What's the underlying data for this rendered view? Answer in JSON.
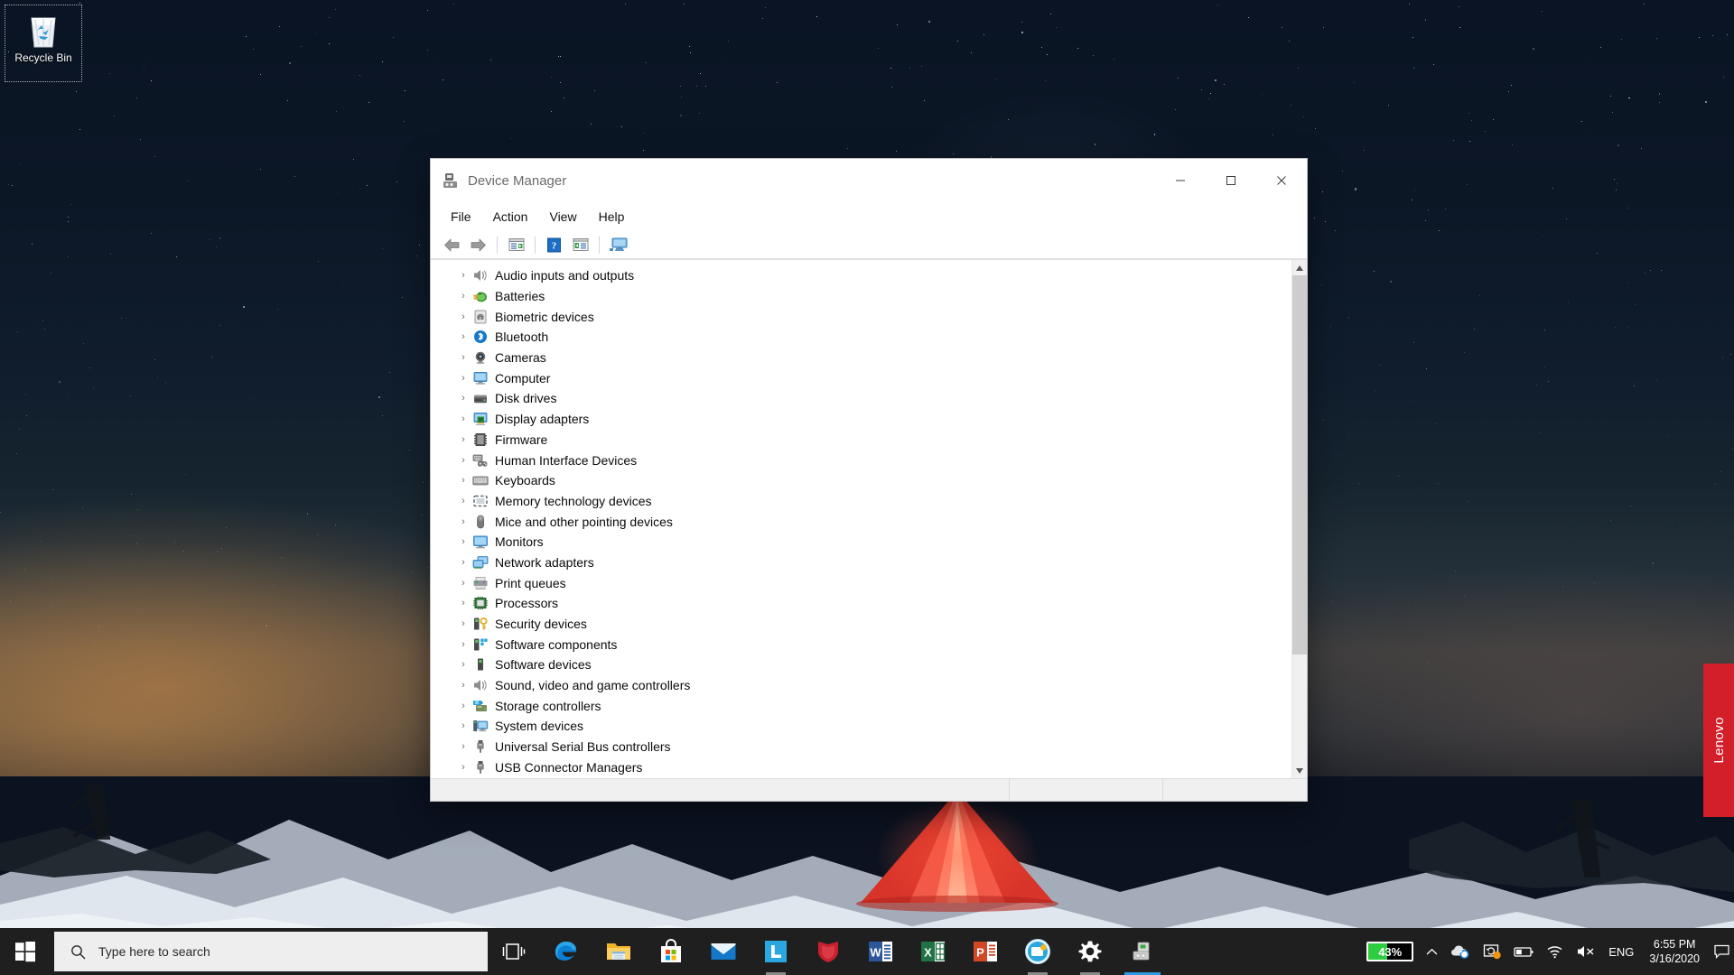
{
  "desktop": {
    "recycle_bin": {
      "label": "Recycle Bin",
      "icon": "recycle-bin-icon"
    },
    "lenovo_tab": {
      "label": "Lenovo"
    }
  },
  "window": {
    "title": "Device Manager",
    "title_icon": "device-manager-icon",
    "controls": {
      "minimize": "—",
      "maximize": "□",
      "close": "✕"
    },
    "menu": [
      {
        "label": "File"
      },
      {
        "label": "Action"
      },
      {
        "label": "View"
      },
      {
        "label": "Help"
      }
    ],
    "toolbar": [
      {
        "name": "back-arrow-icon",
        "title": "Back"
      },
      {
        "name": "forward-arrow-icon",
        "title": "Forward"
      },
      {
        "name": "separator"
      },
      {
        "name": "properties-icon",
        "title": "Properties"
      },
      {
        "name": "separator"
      },
      {
        "name": "help-icon",
        "title": "Help"
      },
      {
        "name": "show-hide-console-tree-icon",
        "title": "Show/Hide Console Tree"
      },
      {
        "name": "separator"
      },
      {
        "name": "scan-hardware-changes-icon",
        "title": "Scan for hardware changes"
      }
    ],
    "tree": [
      {
        "label": "Audio inputs and outputs",
        "icon": "speaker-icon"
      },
      {
        "label": "Batteries",
        "icon": "battery-icon"
      },
      {
        "label": "Biometric devices",
        "icon": "fingerprint-icon"
      },
      {
        "label": "Bluetooth",
        "icon": "bluetooth-icon"
      },
      {
        "label": "Cameras",
        "icon": "camera-icon"
      },
      {
        "label": "Computer",
        "icon": "computer-icon"
      },
      {
        "label": "Disk drives",
        "icon": "disk-drive-icon"
      },
      {
        "label": "Display adapters",
        "icon": "display-adapter-icon"
      },
      {
        "label": "Firmware",
        "icon": "firmware-chip-icon"
      },
      {
        "label": "Human Interface Devices",
        "icon": "hid-icon"
      },
      {
        "label": "Keyboards",
        "icon": "keyboard-icon"
      },
      {
        "label": "Memory technology devices",
        "icon": "memory-icon"
      },
      {
        "label": "Mice and other pointing devices",
        "icon": "mouse-icon"
      },
      {
        "label": "Monitors",
        "icon": "monitor-icon"
      },
      {
        "label": "Network adapters",
        "icon": "network-adapter-icon"
      },
      {
        "label": "Print queues",
        "icon": "printer-icon"
      },
      {
        "label": "Processors",
        "icon": "processor-icon"
      },
      {
        "label": "Security devices",
        "icon": "security-key-icon"
      },
      {
        "label": "Software components",
        "icon": "software-component-icon"
      },
      {
        "label": "Software devices",
        "icon": "software-device-icon"
      },
      {
        "label": "Sound, video and game controllers",
        "icon": "speaker-icon"
      },
      {
        "label": "Storage controllers",
        "icon": "storage-controller-icon"
      },
      {
        "label": "System devices",
        "icon": "system-device-icon"
      },
      {
        "label": "Universal Serial Bus controllers",
        "icon": "usb-icon"
      },
      {
        "label": "USB Connector Managers",
        "icon": "usb-icon"
      }
    ],
    "expander_glyph": "›",
    "scrollbar": {
      "up": "▲",
      "down": "▼"
    }
  },
  "taskbar": {
    "start": {
      "name": "windows-start-icon"
    },
    "search": {
      "placeholder": "Type here to search",
      "icon": "search-icon"
    },
    "apps": [
      {
        "name": "task-view-icon",
        "label": "Task View",
        "state": "none"
      },
      {
        "name": "edge-icon",
        "label": "Microsoft Edge",
        "state": "none"
      },
      {
        "name": "file-explorer-icon",
        "label": "File Explorer",
        "state": "none"
      },
      {
        "name": "microsoft-store-icon",
        "label": "Microsoft Store",
        "state": "none"
      },
      {
        "name": "mail-icon",
        "label": "Mail",
        "state": "none"
      },
      {
        "name": "lenovo-vantage-icon",
        "label": "Lenovo Vantage",
        "state": "open"
      },
      {
        "name": "mcafee-icon",
        "label": "McAfee",
        "state": "none"
      },
      {
        "name": "word-icon",
        "label": "Word",
        "state": "none"
      },
      {
        "name": "excel-icon",
        "label": "Excel",
        "state": "none"
      },
      {
        "name": "powerpoint-icon",
        "label": "PowerPoint",
        "state": "none"
      },
      {
        "name": "snip-sketch-icon",
        "label": "Snip & Sketch",
        "state": "open"
      },
      {
        "name": "settings-gear-icon",
        "label": "Settings",
        "state": "open"
      },
      {
        "name": "device-manager-taskbar-icon",
        "label": "Device Manager",
        "state": "active"
      }
    ],
    "tray": {
      "battery_percent": "43%",
      "battery_fill": 43,
      "show_hidden": "∧",
      "icons": [
        {
          "name": "onedrive-cloud-icon"
        },
        {
          "name": "display-notification-icon"
        },
        {
          "name": "battery-tray-icon"
        },
        {
          "name": "wifi-icon"
        },
        {
          "name": "volume-muted-icon"
        }
      ],
      "language": "ENG",
      "time": "6:55 PM",
      "date": "3/16/2020",
      "action_center": {
        "name": "action-center-icon"
      }
    }
  },
  "colors": {
    "accent": "#2b9ae1",
    "lenovo_red": "#d21f2a",
    "battery_green": "#2ecc40",
    "taskbar": "#1f1f1f",
    "window_chrome": "#ffffff"
  }
}
